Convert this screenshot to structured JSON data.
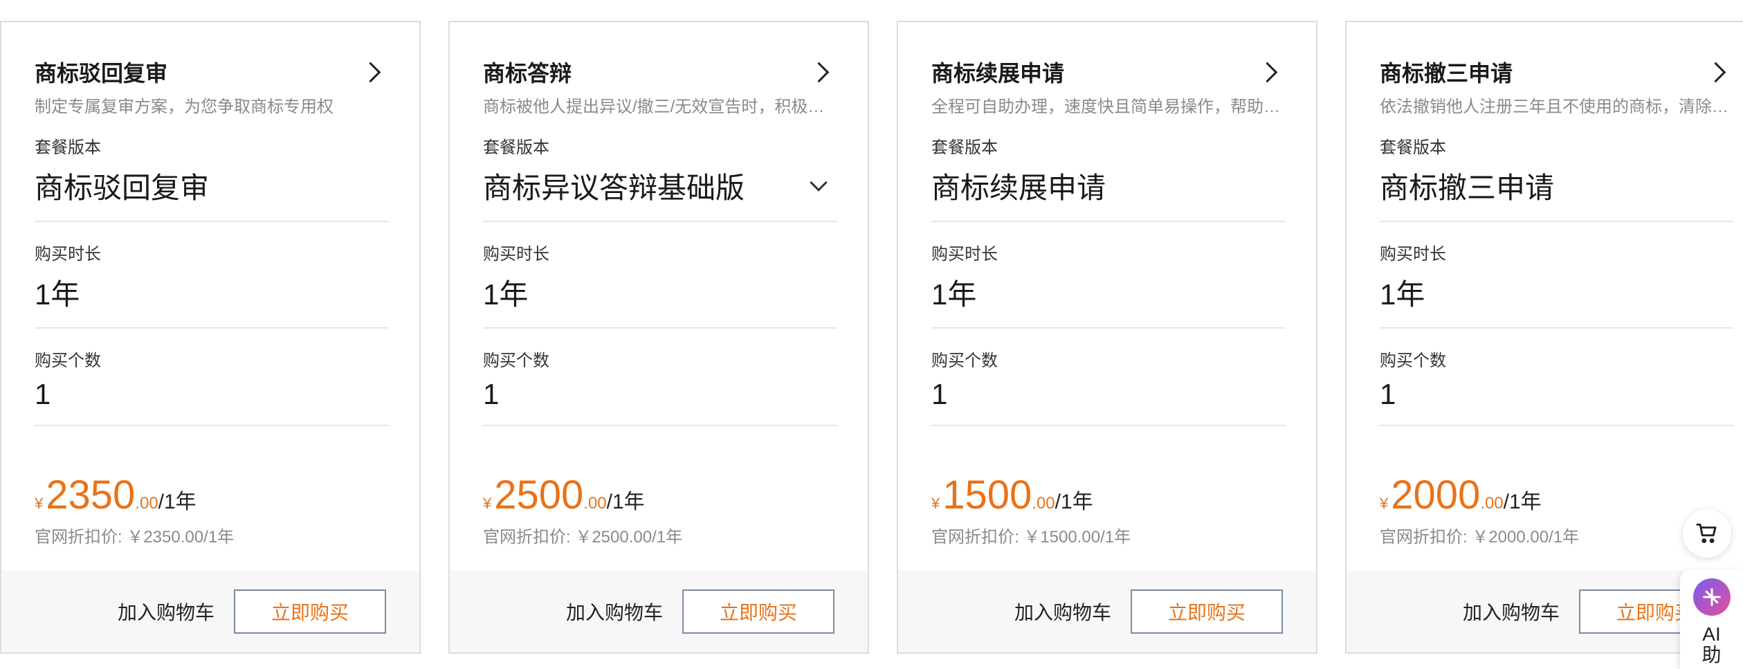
{
  "labels": {
    "version": "套餐版本",
    "duration": "购买时长",
    "quantity": "购买个数",
    "currency": "¥",
    "cart_button": "加入购物车",
    "buy_button": "立即购买"
  },
  "cards": [
    {
      "title": "商标驳回复审",
      "desc": "制定专属复审方案，为您争取商标专用权",
      "version": "商标驳回复审",
      "duration": "1年",
      "quantity": "1",
      "price_int": "2350",
      "price_dec": ".00",
      "price_unit": "/1年",
      "official_price": "官网折扣价: ￥2350.00/1年"
    },
    {
      "title": "商标答辩",
      "desc": "商标被他人提出异议/撤三/无效宣告时，积极应对",
      "version": "商标异议答辩基础版",
      "duration": "1年",
      "quantity": "1",
      "price_int": "2500",
      "price_dec": ".00",
      "price_unit": "/1年",
      "official_price": "官网折扣价: ￥2500.00/1年"
    },
    {
      "title": "商标续展申请",
      "desc": "全程可自助办理，速度快且简单易操作，帮助您延续商标",
      "version": "商标续展申请",
      "duration": "1年",
      "quantity": "1",
      "price_int": "1500",
      "price_dec": ".00",
      "price_unit": "/1年",
      "official_price": "官网折扣价: ￥1500.00/1年"
    },
    {
      "title": "商标撤三申请",
      "desc": "依法撤销他人注册三年且不使用的商标，清除注册障碍",
      "version": "商标撤三申请",
      "duration": "1年",
      "quantity": "1",
      "price_int": "2000",
      "price_dec": ".00",
      "price_unit": "/1年",
      "official_price": "官网折扣价: ￥2000.00/1年"
    }
  ],
  "floating": {
    "cart_icon": "shopping-cart-icon",
    "ai_label": "AI助"
  },
  "colors": {
    "accent": "#e8731a",
    "button_border": "#7a8aa6"
  }
}
